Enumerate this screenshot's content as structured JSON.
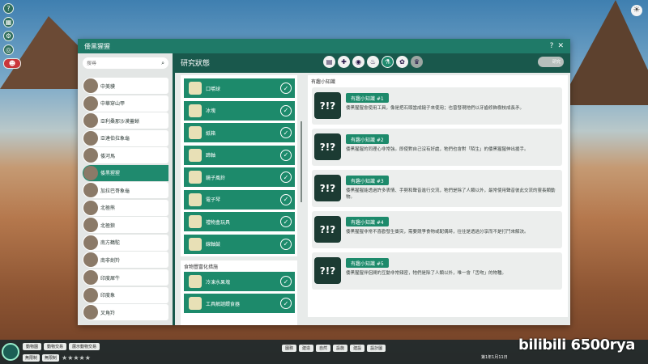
{
  "window": {
    "title": "倭黑猩猩",
    "help": "?",
    "close": "✕"
  },
  "search": {
    "placeholder": "搜尋"
  },
  "animals": [
    {
      "name": "中美貘"
    },
    {
      "name": "中華穿山甲"
    },
    {
      "name": "亞利桑那沙漠蓋蜥"
    },
    {
      "name": "亞達伯拉象龜"
    },
    {
      "name": "倭河馬"
    },
    {
      "name": "倭黑猩猩",
      "selected": true
    },
    {
      "name": "加拉巴哥象龜"
    },
    {
      "name": "北極熊"
    },
    {
      "name": "北極狼"
    },
    {
      "name": "南方鶴駝"
    },
    {
      "name": "南非劍羚"
    },
    {
      "name": "印度犀牛"
    },
    {
      "name": "印度象"
    },
    {
      "name": "叉角羚"
    }
  ],
  "research": {
    "title": "研究狀態",
    "categories": [
      {
        "icon": "book-icon",
        "glyph": "▤"
      },
      {
        "icon": "pill-icon",
        "glyph": "✚"
      },
      {
        "icon": "teeth-icon",
        "glyph": "◉"
      },
      {
        "icon": "food-icon",
        "glyph": "♨"
      },
      {
        "icon": "flask-icon",
        "glyph": "⚗"
      },
      {
        "icon": "paw-icon",
        "glyph": "✿"
      },
      {
        "icon": "trophy-icon",
        "glyph": "♛"
      }
    ],
    "badge": "研究",
    "items": [
      {
        "label": "口嚼球"
      },
      {
        "label": "冰塊"
      },
      {
        "label": "紙箱"
      },
      {
        "label": "蹄軸"
      },
      {
        "label": "鏡子風鈴"
      },
      {
        "label": "電子琴"
      },
      {
        "label": "禮物盒玩具"
      },
      {
        "label": "線軸鼓"
      }
    ],
    "enrichment_title": "食物豐富化措施",
    "enrichment_items": [
      {
        "label": "冷凍水果塊"
      },
      {
        "label": "工具解謎餵食器"
      }
    ]
  },
  "facts": {
    "title": "有趣小知識",
    "items": [
      {
        "title": "有趣小知識 #1",
        "text": "倭黑猩猩會使用工具，像是把石頭當成鎚子來使用；也曾發現牠們以牙齒修飾樹枝成長矛。"
      },
      {
        "title": "有趣小知識 #2",
        "text": "倭黑猩猩的同理心非常強。即使對自己沒有好處，牠們也會對「陌生」的倭黑猩猩伸出援手。"
      },
      {
        "title": "有趣小知識 #3",
        "text": "倭黑猩猩能透過許多表情、手勢和聲音進行交流，牠們是除了人類以外，最常使用聲音彼此交流的靈長類動物。"
      },
      {
        "title": "有趣小知識 #4",
        "text": "倭黑猩猩非常不喜歡發生衝突，需要競爭食物或配偶時，往往是透過分享而不是打鬥來解決。"
      },
      {
        "title": "有趣小知識 #5",
        "text": "倭黑猩猩伴侶間的互動非常頻密，牠們是除了人類以外，唯一會「舌吻」的物種。"
      }
    ]
  },
  "bottom": {
    "tabs": [
      "動物園",
      "動物交易",
      "展示動物交易"
    ],
    "money": "無限制",
    "guests": "無限制",
    "center": [
      "園務",
      "建造",
      "自然",
      "設施",
      "建設",
      "設計圖"
    ],
    "date": "第1年1月11日",
    "watermark": "bilibili 6500rya"
  }
}
